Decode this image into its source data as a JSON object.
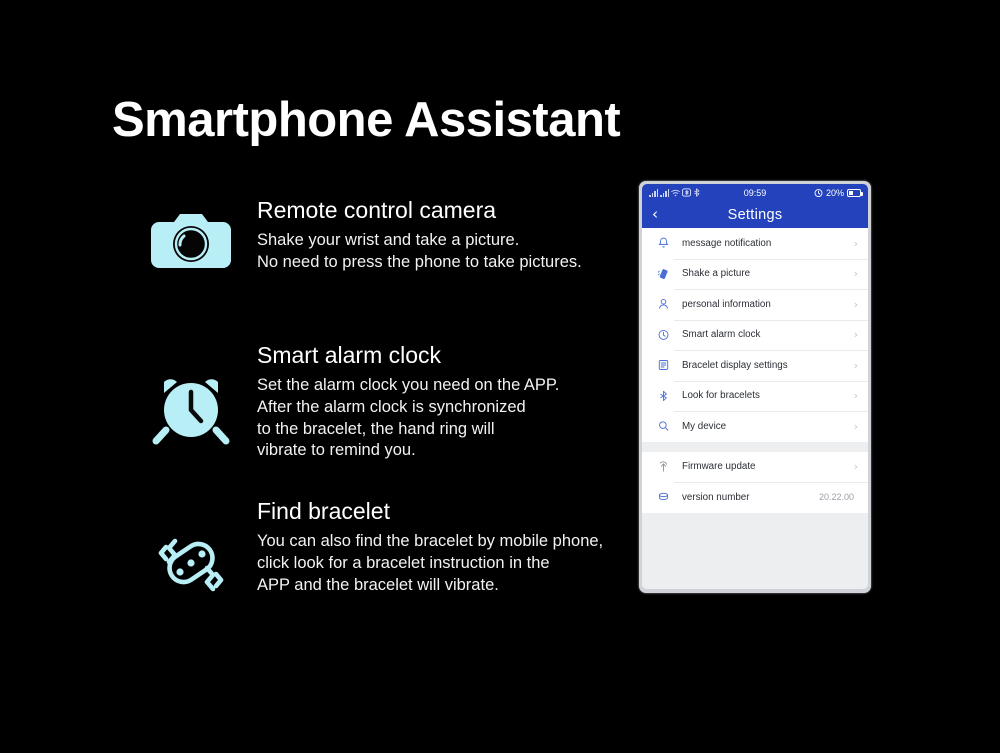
{
  "page": {
    "title": "Smartphone Assistant",
    "background_color": "#000000",
    "accent_icon_color": "#b8eef5"
  },
  "features": [
    {
      "icon": "camera-icon",
      "heading": "Remote control camera",
      "lines": [
        "Shake your wrist and take a picture.",
        "No need to press the phone to take pictures."
      ]
    },
    {
      "icon": "alarm-clock-icon",
      "heading": "Smart alarm clock",
      "lines": [
        "Set the alarm clock you need on the APP.",
        "After the alarm clock is synchronized",
        "to the bracelet, the hand ring will",
        "vibrate to remind you."
      ]
    },
    {
      "icon": "vibrating-bracelet-icon",
      "heading": "Find bracelet",
      "lines": [
        "You can also find the bracelet by mobile phone,",
        "click  look for a bracelet instruction in the",
        "APP and the bracelet will vibrate."
      ]
    }
  ],
  "phone": {
    "status_bar": {
      "time": "09:59",
      "battery_percent": "20%",
      "icons": [
        "signal-bars-icon",
        "signal-bars-icon",
        "wifi-icon",
        "bluetooth-share-icon",
        "bluetooth-icon",
        "alarm-icon",
        "battery-icon"
      ]
    },
    "nav": {
      "back_icon": "chevron-left-icon",
      "title": "Settings"
    },
    "header_color": "#2442bb",
    "settings_groups": [
      {
        "rows": [
          {
            "icon": "bell-icon",
            "label": "message notification",
            "value": "",
            "chevron": true
          },
          {
            "icon": "shake-icon",
            "label": "Shake a picture",
            "value": "",
            "chevron": true
          },
          {
            "icon": "person-icon",
            "label": "personal information",
            "value": "",
            "chevron": true
          },
          {
            "icon": "clock-icon",
            "label": "Smart alarm clock",
            "value": "",
            "chevron": true
          },
          {
            "icon": "display-icon",
            "label": "Bracelet display settings",
            "value": "",
            "chevron": true
          },
          {
            "icon": "bluetooth-icon",
            "label": "Look for bracelets",
            "value": "",
            "chevron": true
          },
          {
            "icon": "search-icon",
            "label": "My device",
            "value": "",
            "chevron": true
          }
        ]
      },
      {
        "rows": [
          {
            "icon": "upload-icon",
            "label": "Firmware update",
            "value": "",
            "chevron": true
          },
          {
            "icon": "database-icon",
            "label": "version number",
            "value": "20.22.00",
            "chevron": false
          }
        ]
      }
    ]
  }
}
